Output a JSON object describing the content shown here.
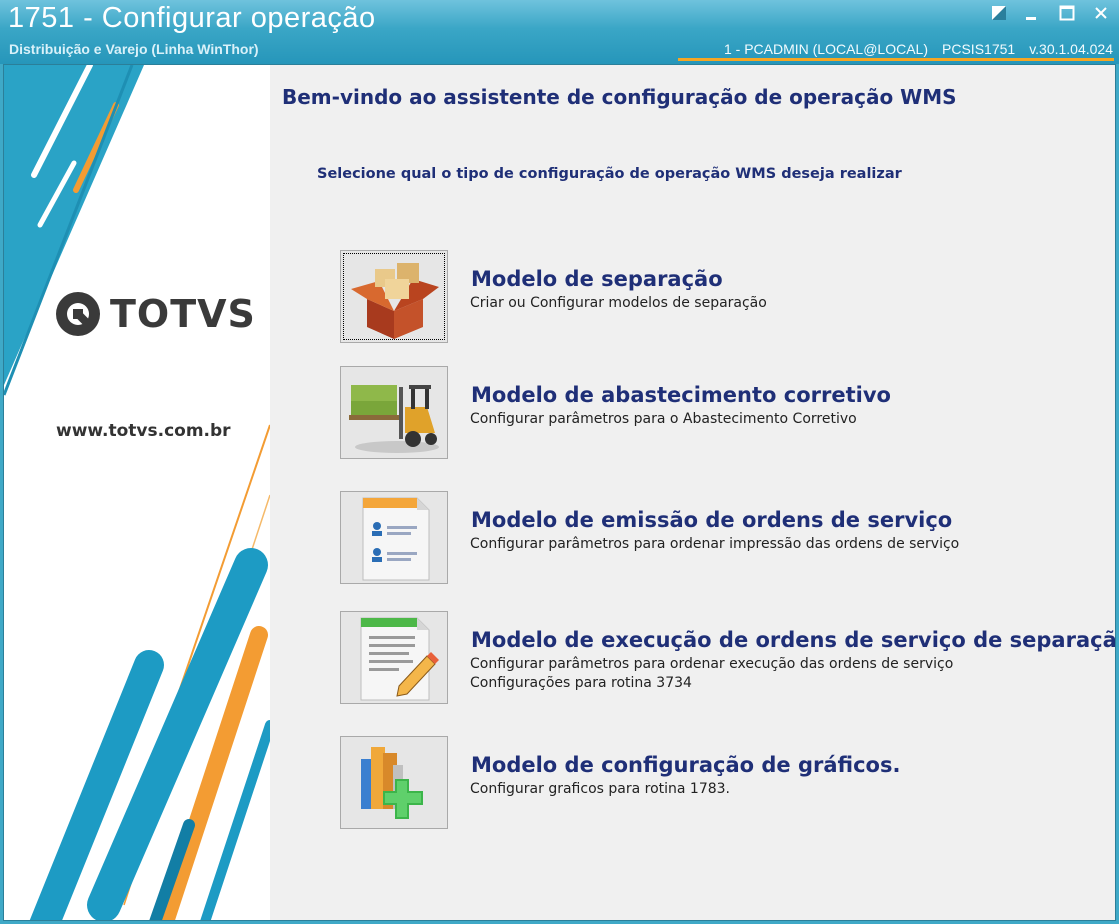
{
  "window": {
    "title": "1751 - Configurar operação",
    "subtitle": "Distribuição e Varejo (Linha WinThor)",
    "status": {
      "user": "1 - PCADMIN (LOCAL@LOCAL)",
      "program": "PCSIS1751",
      "version": "v.30.1.04.024"
    },
    "colors": {
      "accent": "#3aa6c6",
      "status_underline": "#f5a623"
    }
  },
  "sidebar": {
    "brand": "TOTVS",
    "website": "www.totvs.com.br"
  },
  "wizard": {
    "title": "Bem-vindo ao assistente de configuração de operação WMS",
    "instruction": "Selecione qual o tipo de configuração de operação WMS deseja realizar",
    "options": [
      {
        "icon": "open-box-icon",
        "title": "Modelo de separação",
        "desc1": "Criar ou Configurar modelos de separação",
        "desc2": ""
      },
      {
        "icon": "forklift-icon",
        "title": "Modelo de abastecimento corretivo",
        "desc1": "Configurar parâmetros para o Abastecimento Corretivo",
        "desc2": ""
      },
      {
        "icon": "document-users-icon",
        "title": "Modelo de emissão de ordens de serviço",
        "desc1": "Configurar parâmetros para ordenar impressão das ordens de serviço",
        "desc2": ""
      },
      {
        "icon": "document-edit-icon",
        "title": "Modelo de execução de ordens de serviço de separação",
        "desc1": "Configurar parâmetros para ordenar execução das ordens de serviço",
        "desc2": "Configurações para rotina 3734"
      },
      {
        "icon": "chart-add-icon",
        "title": "Modelo de configuração de gráficos.",
        "desc1": "Configurar graficos para rotina 1783.",
        "desc2": ""
      }
    ]
  }
}
